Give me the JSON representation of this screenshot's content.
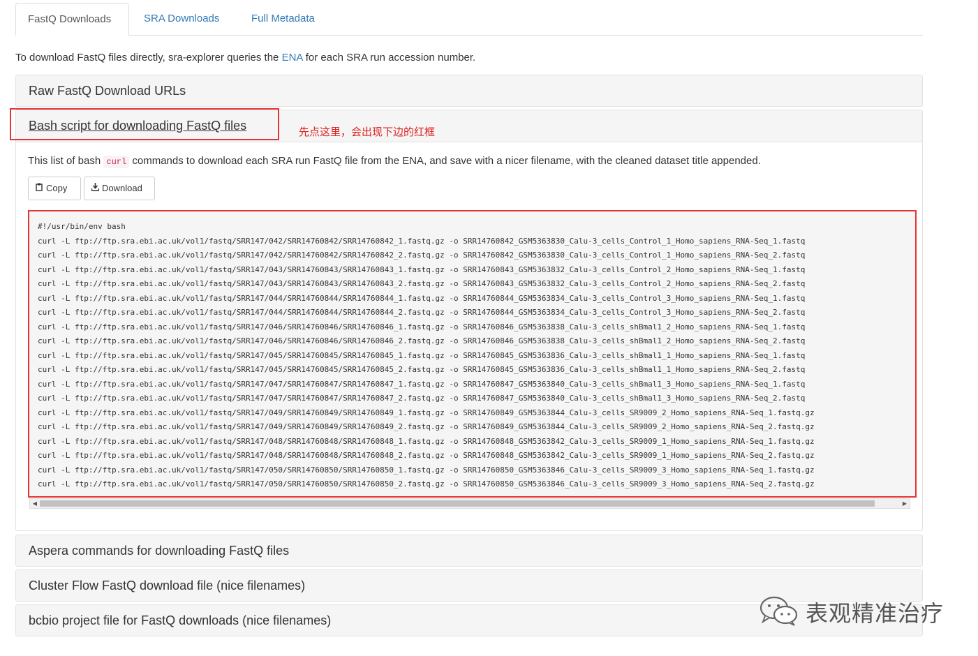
{
  "tabs": [
    {
      "label": "FastQ Downloads",
      "active": true
    },
    {
      "label": "SRA Downloads",
      "active": false
    },
    {
      "label": "Full Metadata",
      "active": false
    }
  ],
  "intro": {
    "before": "To download FastQ files directly, sra-explorer queries the ",
    "link": "ENA",
    "after": " for each SRA run accession number."
  },
  "panels": {
    "raw_urls": "Raw FastQ Download URLs",
    "bash": "Bash script for downloading FastQ files",
    "aspera": "Aspera commands for downloading FastQ files",
    "cluster_flow": "Cluster Flow FastQ download file (nice filenames)",
    "bcbio": "bcbio project file for FastQ downloads (nice filenames)"
  },
  "annotation": "先点这里，会出现下边的红框",
  "description": {
    "before": "This list of bash ",
    "code": "curl",
    "after": " commands to download each SRA run FastQ file from the ENA, and save with a nicer filename, with the cleaned dataset title appended."
  },
  "buttons": {
    "copy": "Copy",
    "download": "Download"
  },
  "script_lines": [
    "#!/usr/bin/env bash",
    "curl -L ftp://ftp.sra.ebi.ac.uk/vol1/fastq/SRR147/042/SRR14760842/SRR14760842_1.fastq.gz -o SRR14760842_GSM5363830_Calu-3_cells_Control_1_Homo_sapiens_RNA-Seq_1.fastq",
    "curl -L ftp://ftp.sra.ebi.ac.uk/vol1/fastq/SRR147/042/SRR14760842/SRR14760842_2.fastq.gz -o SRR14760842_GSM5363830_Calu-3_cells_Control_1_Homo_sapiens_RNA-Seq_2.fastq",
    "curl -L ftp://ftp.sra.ebi.ac.uk/vol1/fastq/SRR147/043/SRR14760843/SRR14760843_1.fastq.gz -o SRR14760843_GSM5363832_Calu-3_cells_Control_2_Homo_sapiens_RNA-Seq_1.fastq",
    "curl -L ftp://ftp.sra.ebi.ac.uk/vol1/fastq/SRR147/043/SRR14760843/SRR14760843_2.fastq.gz -o SRR14760843_GSM5363832_Calu-3_cells_Control_2_Homo_sapiens_RNA-Seq_2.fastq",
    "curl -L ftp://ftp.sra.ebi.ac.uk/vol1/fastq/SRR147/044/SRR14760844/SRR14760844_1.fastq.gz -o SRR14760844_GSM5363834_Calu-3_cells_Control_3_Homo_sapiens_RNA-Seq_1.fastq",
    "curl -L ftp://ftp.sra.ebi.ac.uk/vol1/fastq/SRR147/044/SRR14760844/SRR14760844_2.fastq.gz -o SRR14760844_GSM5363834_Calu-3_cells_Control_3_Homo_sapiens_RNA-Seq_2.fastq",
    "curl -L ftp://ftp.sra.ebi.ac.uk/vol1/fastq/SRR147/046/SRR14760846/SRR14760846_1.fastq.gz -o SRR14760846_GSM5363838_Calu-3_cells_shBmal1_2_Homo_sapiens_RNA-Seq_1.fastq",
    "curl -L ftp://ftp.sra.ebi.ac.uk/vol1/fastq/SRR147/046/SRR14760846/SRR14760846_2.fastq.gz -o SRR14760846_GSM5363838_Calu-3_cells_shBmal1_2_Homo_sapiens_RNA-Seq_2.fastq",
    "curl -L ftp://ftp.sra.ebi.ac.uk/vol1/fastq/SRR147/045/SRR14760845/SRR14760845_1.fastq.gz -o SRR14760845_GSM5363836_Calu-3_cells_shBmal1_1_Homo_sapiens_RNA-Seq_1.fastq",
    "curl -L ftp://ftp.sra.ebi.ac.uk/vol1/fastq/SRR147/045/SRR14760845/SRR14760845_2.fastq.gz -o SRR14760845_GSM5363836_Calu-3_cells_shBmal1_1_Homo_sapiens_RNA-Seq_2.fastq",
    "curl -L ftp://ftp.sra.ebi.ac.uk/vol1/fastq/SRR147/047/SRR14760847/SRR14760847_1.fastq.gz -o SRR14760847_GSM5363840_Calu-3_cells_shBmal1_3_Homo_sapiens_RNA-Seq_1.fastq",
    "curl -L ftp://ftp.sra.ebi.ac.uk/vol1/fastq/SRR147/047/SRR14760847/SRR14760847_2.fastq.gz -o SRR14760847_GSM5363840_Calu-3_cells_shBmal1_3_Homo_sapiens_RNA-Seq_2.fastq",
    "curl -L ftp://ftp.sra.ebi.ac.uk/vol1/fastq/SRR147/049/SRR14760849/SRR14760849_1.fastq.gz -o SRR14760849_GSM5363844_Calu-3_cells_SR9009_2_Homo_sapiens_RNA-Seq_1.fastq.gz",
    "curl -L ftp://ftp.sra.ebi.ac.uk/vol1/fastq/SRR147/049/SRR14760849/SRR14760849_2.fastq.gz -o SRR14760849_GSM5363844_Calu-3_cells_SR9009_2_Homo_sapiens_RNA-Seq_2.fastq.gz",
    "curl -L ftp://ftp.sra.ebi.ac.uk/vol1/fastq/SRR147/048/SRR14760848/SRR14760848_1.fastq.gz -o SRR14760848_GSM5363842_Calu-3_cells_SR9009_1_Homo_sapiens_RNA-Seq_1.fastq.gz",
    "curl -L ftp://ftp.sra.ebi.ac.uk/vol1/fastq/SRR147/048/SRR14760848/SRR14760848_2.fastq.gz -o SRR14760848_GSM5363842_Calu-3_cells_SR9009_1_Homo_sapiens_RNA-Seq_2.fastq.gz",
    "curl -L ftp://ftp.sra.ebi.ac.uk/vol1/fastq/SRR147/050/SRR14760850/SRR14760850_1.fastq.gz -o SRR14760850_GSM5363846_Calu-3_cells_SR9009_3_Homo_sapiens_RNA-Seq_1.fastq.gz",
    "curl -L ftp://ftp.sra.ebi.ac.uk/vol1/fastq/SRR147/050/SRR14760850/SRR14760850_2.fastq.gz -o SRR14760850_GSM5363846_Calu-3_cells_SR9009_3_Homo_sapiens_RNA-Seq_2.fastq.gz"
  ],
  "watermark": "表观精准治疗",
  "colors": {
    "link": "#337ab7",
    "highlight_red": "#e53333",
    "annotation_red": "#e02020"
  },
  "icons": {
    "copy": "clipboard-icon",
    "download": "download-icon",
    "watermark": "wechat-icon"
  }
}
